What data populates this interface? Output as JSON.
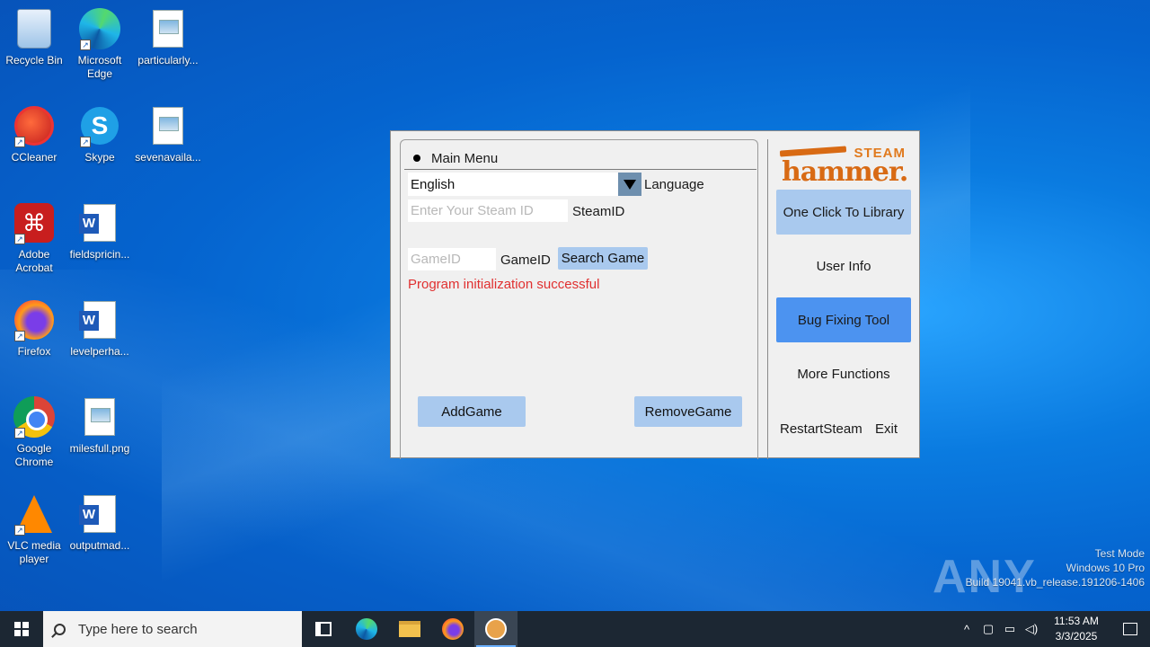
{
  "desktop": {
    "icons": [
      {
        "label": "Recycle Bin",
        "icon": "recycle-bin-icon"
      },
      {
        "label": "Microsoft Edge",
        "icon": "edge-icon"
      },
      {
        "label": "particularly...",
        "icon": "image-file-icon"
      },
      {
        "label": "CCleaner",
        "icon": "ccleaner-icon"
      },
      {
        "label": "Skype",
        "icon": "skype-icon"
      },
      {
        "label": "sevenavaila...",
        "icon": "image-file-icon"
      },
      {
        "label": "Adobe Acrobat",
        "icon": "acrobat-icon"
      },
      {
        "label": "fieldspricin...",
        "icon": "word-doc-icon"
      },
      {
        "label": "Firefox",
        "icon": "firefox-icon"
      },
      {
        "label": "levelperha...",
        "icon": "word-doc-icon"
      },
      {
        "label": "Google Chrome",
        "icon": "chrome-icon"
      },
      {
        "label": "milesfull.png",
        "icon": "image-file-icon"
      },
      {
        "label": "VLC media player",
        "icon": "vlc-icon"
      },
      {
        "label": "outputmad...",
        "icon": "word-doc-icon"
      }
    ]
  },
  "app": {
    "menu_title": "Main Menu",
    "language": {
      "selected": "English",
      "label": "Language"
    },
    "steamid": {
      "placeholder": "Enter Your Steam ID",
      "label": "SteamID"
    },
    "gameid": {
      "placeholder": "GameID",
      "label": "GameID"
    },
    "search_button": "Search Game",
    "status": "Program initialization successful",
    "add_button": "AddGame",
    "remove_button": "RemoveGame",
    "logo": {
      "top": "STEAM",
      "main": "hammer."
    },
    "sidebar": {
      "library": "One Click To Library",
      "user_info": "User Info",
      "bug_tool": "Bug Fixing Tool",
      "more": "More Functions",
      "restart": "RestartSteam",
      "exit": "Exit"
    }
  },
  "watermark": {
    "brand": "ANY RUN",
    "line1": "Test Mode",
    "line2": "Windows 10 Pro",
    "line3": "Build 19041.vb_release.191206-1406"
  },
  "taskbar": {
    "search_placeholder": "Type here to search",
    "time": "11:53 AM",
    "date": "3/3/2025"
  },
  "colors": {
    "accent_light": "#a9c9ee",
    "accent_active": "#4c93f0",
    "status_red": "#e03030",
    "logo_orange": "#d86a14"
  }
}
